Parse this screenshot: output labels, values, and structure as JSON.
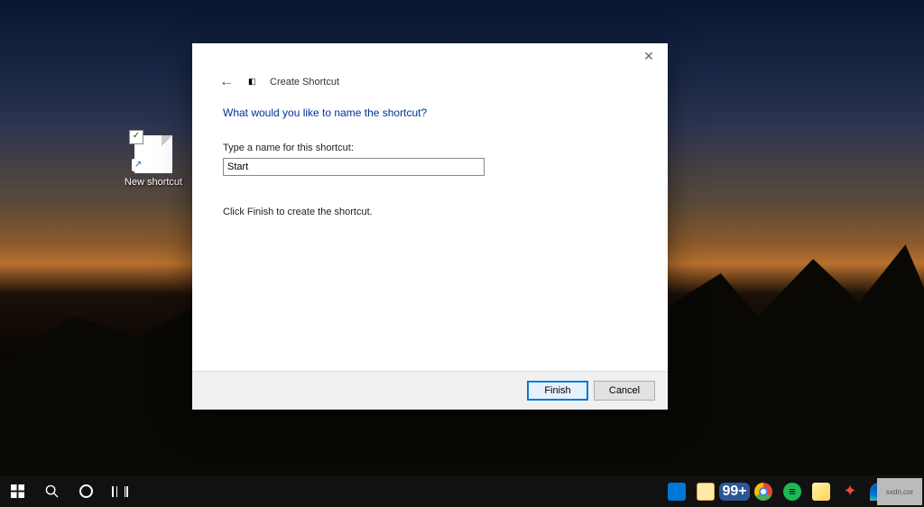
{
  "desktop": {
    "shortcut": {
      "label": "New shortcut"
    }
  },
  "dialog": {
    "title": "Create Shortcut",
    "heading": "What would you like to name the shortcut?",
    "field_label": "Type a name for this shortcut:",
    "input_value": "Start",
    "helper": "Click Finish to create the shortcut.",
    "buttons": {
      "finish": "Finish",
      "cancel": "Cancel"
    }
  },
  "taskbar": {
    "badge": "99+"
  },
  "watermark": "sxdn.cor"
}
